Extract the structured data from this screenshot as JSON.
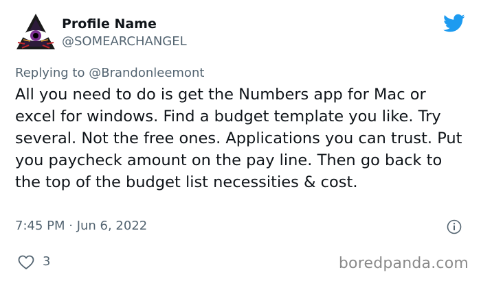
{
  "tweet": {
    "name": "Profile Name",
    "handle": "@SOMEARCHANGEL",
    "replying_prefix": "Replying to",
    "replying_to": "@Brandonleemont",
    "text": "All you need to do is get the Numbers app for Mac or excel for windows. Find a budget template you like. Try several. Not the free ones. Applications you can trust. Put you paycheck amount on the pay line. Then go back to the top of the budget list necessities & cost.",
    "timestamp": "7:45 PM · Jun 6, 2022",
    "likes": "3"
  },
  "icons": {
    "avatar": "eye-pyramid-avatar",
    "brand": "twitter-bird-icon",
    "info": "info-icon",
    "like": "heart-icon"
  },
  "colors": {
    "brand": "#1d9bf0",
    "secondary_text": "#536471"
  },
  "watermark": "boredpanda.com"
}
